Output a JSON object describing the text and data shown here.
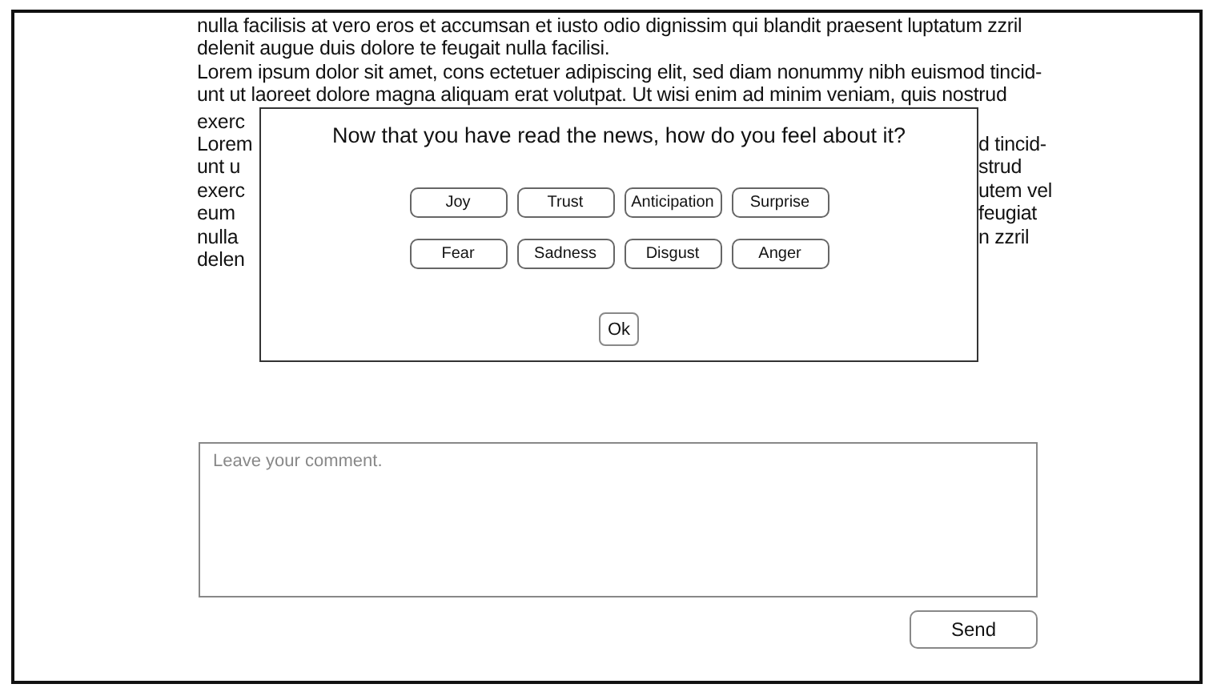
{
  "article": {
    "paragraphs": [
      {
        "lines": [
          {
            "kind": "full",
            "text": "nulla facilisis at vero eros et accumsan et iusto odio dignissim qui blandit praesent luptatum zzril"
          },
          {
            "kind": "full",
            "text": "delenit augue duis dolore te feugait nulla facilisi."
          }
        ]
      },
      {
        "lines": [
          {
            "kind": "full",
            "text": "Lorem ipsum dolor sit amet, cons ectetuer adipiscing elit, sed diam nonummy nibh euismod tincid-"
          },
          {
            "kind": "full",
            "text": "unt ut laoreet dolore magna aliquam erat volutpat. Ut wisi enim ad minim veniam, quis nostrud"
          },
          {
            "kind": "split",
            "left": "exerc"
          }
        ]
      },
      {
        "lines": [
          {
            "kind": "split",
            "left": "Lorem",
            "right": "d tincid-"
          },
          {
            "kind": "split",
            "left": "unt u",
            "right": "strud"
          },
          {
            "kind": "split",
            "left": "exerc",
            "right": "utem vel"
          },
          {
            "kind": "split",
            "left": "eum",
            "right": "feugiat"
          },
          {
            "kind": "split",
            "left": "nulla",
            "right": "n zzril"
          },
          {
            "kind": "split",
            "left": "delen"
          }
        ]
      }
    ]
  },
  "dialog": {
    "question": "Now that you have read the news, how do you feel about it?",
    "emotion_rows": [
      [
        "Joy",
        "Trust",
        "Anticipation",
        "Surprise"
      ],
      [
        "Fear",
        "Sadness",
        "Disgust",
        "Anger"
      ]
    ],
    "ok_button": "Ok"
  },
  "comment": {
    "placeholder": "Leave your comment.",
    "send_button": "Send"
  }
}
